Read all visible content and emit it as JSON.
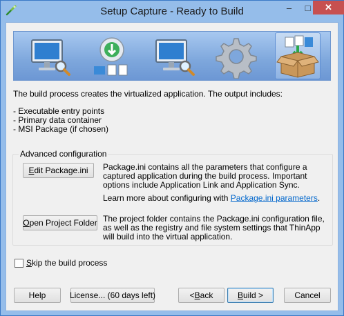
{
  "window": {
    "title": "Setup Capture - Ready to Build",
    "controls": {
      "minimize": "–",
      "maximize": "□",
      "close": "✕"
    }
  },
  "banner": {
    "steps": [
      {
        "icon": "monitor-magnifier-icon",
        "active": false
      },
      {
        "icon": "cd-install-icon",
        "active": false
      },
      {
        "icon": "monitor-magnifier-icon",
        "active": false
      },
      {
        "icon": "gear-icon",
        "active": false
      },
      {
        "icon": "package-box-icon",
        "active": true
      }
    ]
  },
  "intro": "The build process creates the virtualized application. The output includes:",
  "outputs": [
    "- Executable entry points",
    "- Primary data container",
    "- MSI Package (if chosen)"
  ],
  "advanced": {
    "title": "Advanced configuration",
    "edit_button": {
      "prefix": "",
      "mnemonic": "E",
      "rest": "dit Package.ini"
    },
    "edit_description": "Package.ini contains all the parameters that configure a captured application during the build process. Important options include Application Link and Application Sync.",
    "learn_more_text": "Learn more about configuring with ",
    "learn_more_link": "Package.ini parameters",
    "learn_more_suffix": ".",
    "open_button": {
      "prefix": "",
      "mnemonic": "O",
      "rest": "pen Project Folder"
    },
    "open_description": "The project folder contains the Package.ini configuration file, as well as the registry and file system settings that ThinApp will build into the virtual application."
  },
  "skip": {
    "prefix": "",
    "mnemonic": "S",
    "rest": "kip the build process",
    "checked": false
  },
  "footer": {
    "help": "Help",
    "license": "License... (60 days left)",
    "back": {
      "prefix": "< ",
      "mnemonic": "B",
      "rest": "ack"
    },
    "build": {
      "prefix": "",
      "mnemonic": "B",
      "rest": "uild >"
    },
    "cancel": "Cancel"
  },
  "colors": {
    "accent": "#3c7fb1",
    "link": "#0066cc",
    "close_button": "#c75050"
  }
}
